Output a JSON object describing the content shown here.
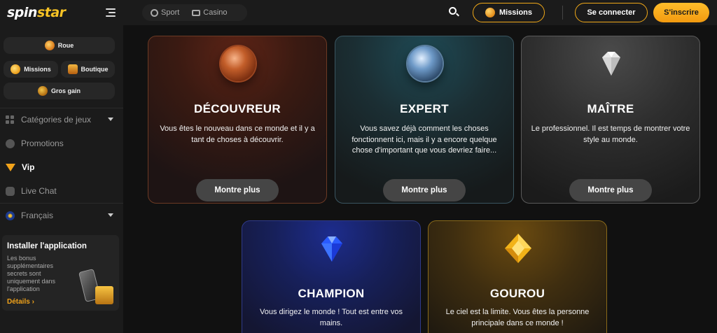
{
  "header": {
    "logo_part1": "spin",
    "logo_part2": "star",
    "nav": [
      {
        "label": "Sport",
        "icon": "ball-icon"
      },
      {
        "label": "Casino",
        "icon": "casino-icon"
      }
    ],
    "missions_label": "Missions",
    "login_label": "Se connecter",
    "signup_label": "S'inscrire"
  },
  "sidebar": {
    "quick": [
      {
        "label": "Roue",
        "icon": "wheel-icon"
      },
      {
        "label": "Missions",
        "icon": "coin-icon"
      },
      {
        "label": "Boutique",
        "icon": "chest-icon"
      },
      {
        "label": "Gros gain",
        "icon": "cookie-icon"
      }
    ],
    "menu": [
      {
        "label": "Catégories de jeux",
        "icon": "grid-icon"
      },
      {
        "label": "Promotions",
        "icon": "promo-icon"
      },
      {
        "label": "Vip",
        "icon": "diamond-icon"
      },
      {
        "label": "Live Chat",
        "icon": "chat-icon"
      },
      {
        "label": "Français",
        "icon": "eu-flag-icon"
      }
    ],
    "install": {
      "title": "Installer l'application",
      "text": "Les bonus supplémentaires secrets sont uniquement dans l'application",
      "link": "Détails"
    }
  },
  "levels": [
    {
      "title": "DÉCOUVREUR",
      "desc": "Vous êtes le nouveau dans ce monde et il y a tant de choses à découvrir.",
      "button": "Montre plus",
      "badge": "bronze-medal-icon"
    },
    {
      "title": "EXPERT",
      "desc": "Vous savez déjà comment les choses fonctionnent ici, mais il y a encore quelque chose d'important que vous devriez faire...",
      "button": "Montre plus",
      "badge": "silver-medal-icon"
    },
    {
      "title": "MAÎTRE",
      "desc": "Le professionnel. Il est temps de montrer votre style au monde.",
      "button": "Montre plus",
      "badge": "white-diamond-icon"
    },
    {
      "title": "CHAMPION",
      "desc": "Vous dirigez le monde ! Tout est entre vos mains.",
      "badge": "blue-diamond-icon"
    },
    {
      "title": "GOUROU",
      "desc": "Le ciel est la limite. Vous êtes la personne principale dans ce monde !",
      "badge": "gold-gem-icon"
    }
  ]
}
